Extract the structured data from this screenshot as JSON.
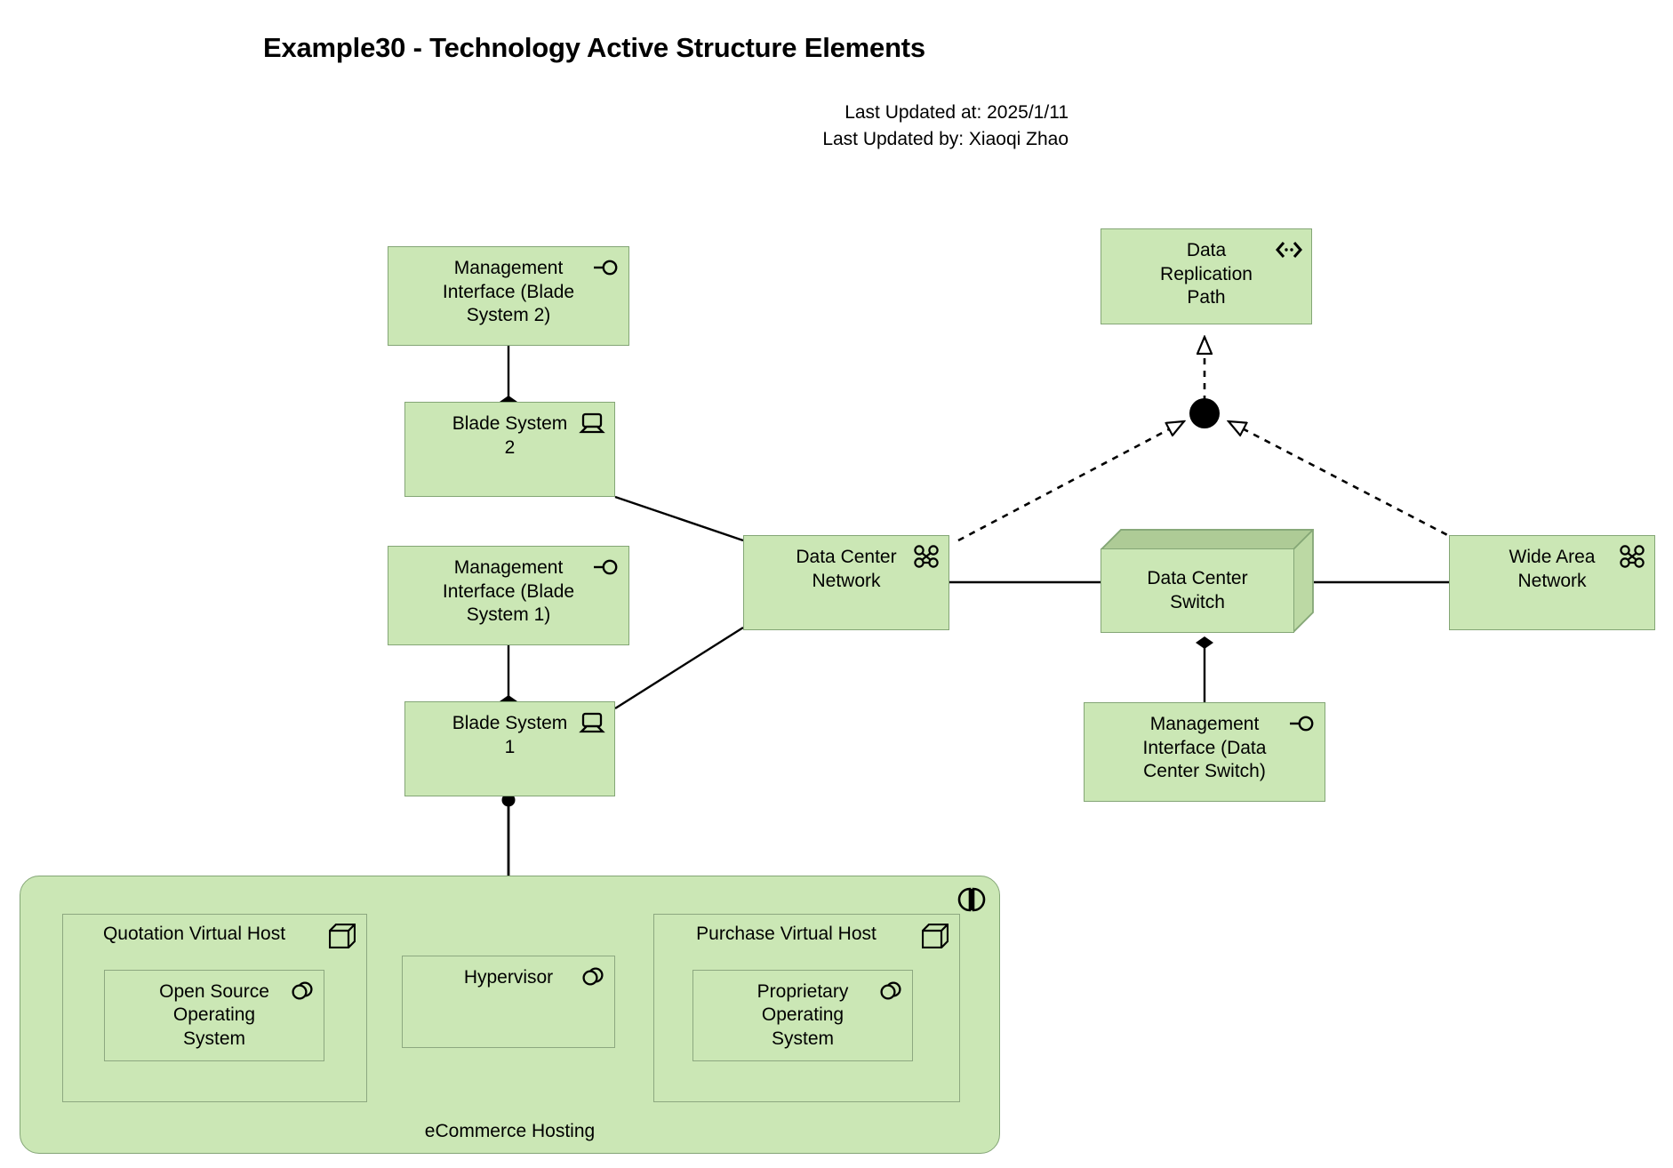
{
  "header": {
    "title": "Example30 - Technology Active Structure Elements",
    "last_updated_at": "Last Updated at: 2025/1/11",
    "last_updated_by": "Last Updated by: Xiaoqi Zhao"
  },
  "colors": {
    "element_fill": "#cbe7b5",
    "element_border": "#84a676",
    "node_top_fill": "#aecb96",
    "node_side_fill": "#bcd9a4",
    "line": "#000000",
    "background": "#ffffff"
  },
  "elements": {
    "mgmt_iface_blade2": {
      "label": "Management\nInterface (Blade\nSystem 2)",
      "type": "Technology Interface",
      "icon": "interface-icon"
    },
    "blade_system_2": {
      "label": "Blade System\n2",
      "type": "Device",
      "icon": "device-icon"
    },
    "mgmt_iface_blade1": {
      "label": "Management\nInterface (Blade\nSystem 1)",
      "type": "Technology Interface",
      "icon": "interface-icon"
    },
    "blade_system_1": {
      "label": "Blade System\n1",
      "type": "Device",
      "icon": "device-icon"
    },
    "data_center_network": {
      "label": "Data Center\nNetwork",
      "type": "Communication Network",
      "icon": "communication-network-icon"
    },
    "data_replication_path": {
      "label": "Data\nReplication\nPath",
      "type": "Path",
      "icon": "path-icon"
    },
    "data_center_switch": {
      "label": "Data Center\nSwitch",
      "type": "Node",
      "icon": "node-3d-icon"
    },
    "wide_area_network": {
      "label": "Wide Area\nNetwork",
      "type": "Communication Network",
      "icon": "communication-network-icon"
    },
    "mgmt_iface_switch": {
      "label": "Management\nInterface (Data\nCenter Switch)",
      "type": "Technology Interface",
      "icon": "interface-icon"
    },
    "ecommerce_hosting": {
      "label": "eCommerce Hosting",
      "type": "Facility",
      "icon": "facility-icon"
    },
    "quotation_virtual_host": {
      "label": "Quotation Virtual Host",
      "type": "Node",
      "icon": "node-icon"
    },
    "purchase_virtual_host": {
      "label": "Purchase Virtual Host",
      "type": "Node",
      "icon": "node-icon"
    },
    "open_source_os": {
      "label": "Open Source\nOperating\nSystem",
      "type": "System Software",
      "icon": "system-software-icon"
    },
    "proprietary_os": {
      "label": "Proprietary\nOperating\nSystem",
      "type": "System Software",
      "icon": "system-software-icon"
    },
    "hypervisor": {
      "label": "Hypervisor",
      "type": "System Software",
      "icon": "system-software-icon"
    },
    "junction": {
      "label": "",
      "type": "And Junction",
      "icon": "junction-icon"
    }
  },
  "relationships": [
    {
      "name": "composition-mgmt-iface-blade2-to-blade2",
      "from": "mgmt_iface_blade2",
      "to": "blade_system_2",
      "type": "Composition"
    },
    {
      "name": "composition-mgmt-iface-blade1-to-blade1",
      "from": "mgmt_iface_blade1",
      "to": "blade_system_1",
      "type": "Composition"
    },
    {
      "name": "association-blade2-to-dcn",
      "from": "blade_system_2",
      "to": "data_center_network",
      "type": "Association"
    },
    {
      "name": "association-blade1-to-dcn",
      "from": "blade_system_1",
      "to": "data_center_network",
      "type": "Association"
    },
    {
      "name": "association-dcn-to-switch",
      "from": "data_center_network",
      "to": "data_center_switch",
      "type": "Association"
    },
    {
      "name": "association-switch-to-wan",
      "from": "data_center_switch",
      "to": "wide_area_network",
      "type": "Association"
    },
    {
      "name": "composition-mgmt-iface-switch-to-switch",
      "from": "mgmt_iface_switch",
      "to": "data_center_switch",
      "type": "Composition"
    },
    {
      "name": "realization-dcn-to-junction",
      "from": "data_center_network",
      "to": "junction",
      "type": "Realization"
    },
    {
      "name": "realization-wan-to-junction",
      "from": "wide_area_network",
      "to": "junction",
      "type": "Realization"
    },
    {
      "name": "realization-junction-to-path",
      "from": "junction",
      "to": "data_replication_path",
      "type": "Realization"
    },
    {
      "name": "assignment-blade1-to-hypervisor",
      "from": "blade_system_1",
      "to": "hypervisor",
      "type": "Assignment"
    },
    {
      "name": "assignment-hypervisor-to-open-source-os",
      "from": "hypervisor",
      "to": "open_source_os",
      "type": "Assignment"
    },
    {
      "name": "assignment-hypervisor-to-proprietary-os",
      "from": "hypervisor",
      "to": "proprietary_os",
      "type": "Assignment"
    }
  ]
}
